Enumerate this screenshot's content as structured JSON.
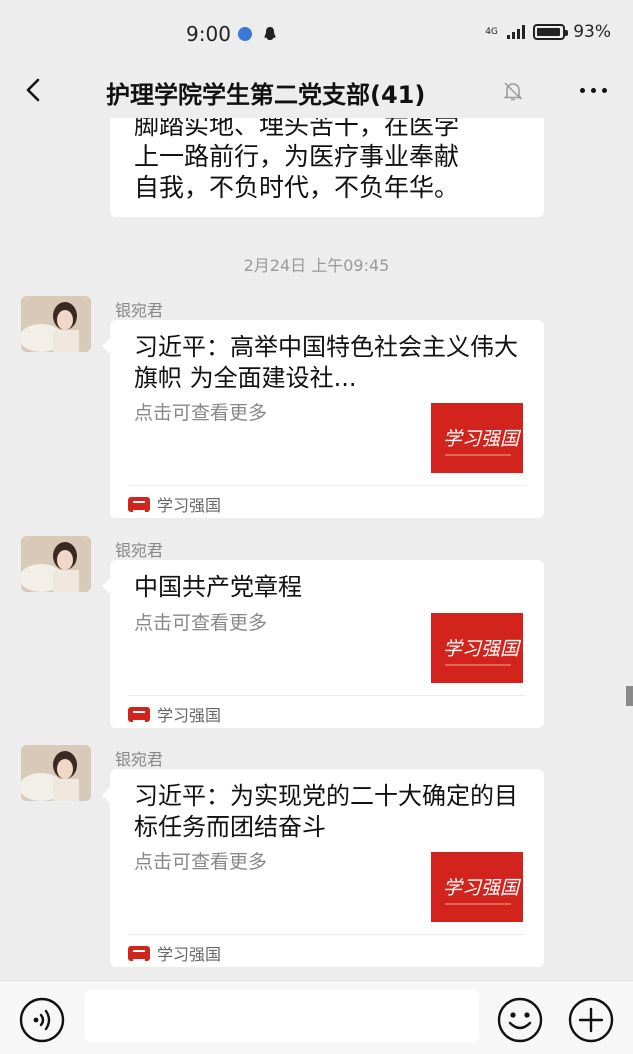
{
  "status_bar": {
    "time": "9:00",
    "network": "4G",
    "battery": "93%",
    "battery_level": 0.93
  },
  "header": {
    "title": "护理学院学生第二党支部(41)",
    "back_icon": "back-arrow-icon",
    "mute_icon": "bell-muted-icon",
    "more_icon": "more-icon"
  },
  "messages": {
    "partial_text": [
      "脚踏实地、埋头苦干，在医学",
      "上一路前行，为医疗事业奉献",
      "自我，不负时代，不负年华。"
    ],
    "timestamp": "2月24日 上午09:45",
    "cards": [
      {
        "sender": "银宛君",
        "title": "习近平：高举中国特色社会主义伟大旗帜 为全面建设社...",
        "desc": "点击可查看更多",
        "thumb_text": "学习强国",
        "source": "学习强国"
      },
      {
        "sender": "银宛君",
        "title": "中国共产党章程",
        "desc": "点击可查看更多",
        "thumb_text": "学习强国",
        "source": "学习强国"
      },
      {
        "sender": "银宛君",
        "title": "习近平：为实现党的二十大确定的目标任务而团结奋斗",
        "desc": "点击可查看更多",
        "thumb_text": "学习强国",
        "source": "学习强国"
      }
    ]
  },
  "input_bar": {
    "voice_icon": "voice-icon",
    "text_value": "",
    "emoji_icon": "emoji-icon",
    "plus_icon": "plus-icon"
  },
  "colors": {
    "background": "#ededed",
    "bubble": "#ffffff",
    "brand_red": "#d2231c",
    "muted_text": "#888888"
  }
}
